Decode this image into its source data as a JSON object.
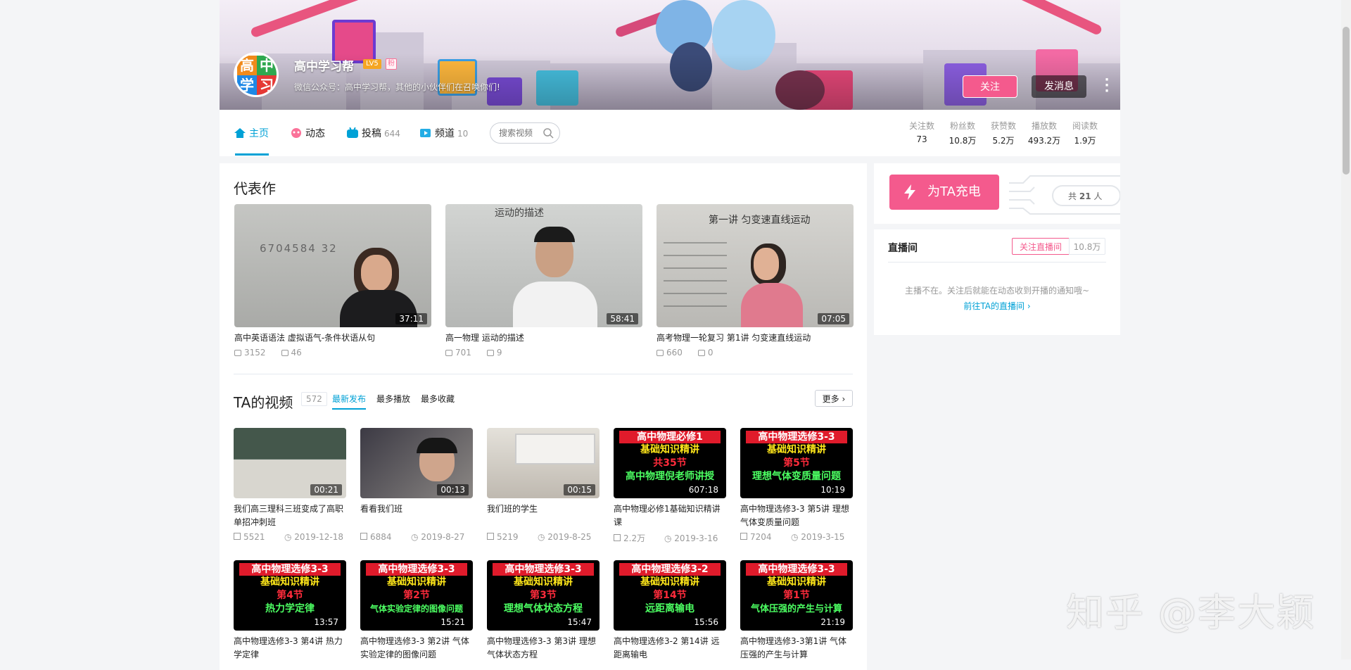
{
  "profile": {
    "name": "高中学习帮",
    "level": "LV5",
    "fan_badge": "粉",
    "avatar_text": [
      "高",
      "中",
      "学",
      "习"
    ],
    "sign": "微信公众号：高中学习帮，其他的小伙伴们在召唤你们!",
    "follow_label": "关注",
    "message_label": "发消息"
  },
  "nav": {
    "items": [
      {
        "label": "主页",
        "count": ""
      },
      {
        "label": "动态",
        "count": ""
      },
      {
        "label": "投稿",
        "count": "644"
      },
      {
        "label": "频道",
        "count": "10"
      }
    ],
    "search_placeholder": "搜索视频"
  },
  "stats": [
    {
      "label": "关注数",
      "value": "73"
    },
    {
      "label": "粉丝数",
      "value": "10.8万"
    },
    {
      "label": "获赞数",
      "value": "5.2万"
    },
    {
      "label": "播放数",
      "value": "493.2万"
    },
    {
      "label": "阅读数",
      "value": "1.9万"
    }
  ],
  "representative": {
    "title": "代表作",
    "items": [
      {
        "title": "高中英语语法 虚拟语气-条件状语从句",
        "duration": "37:11",
        "plays": "3152",
        "danmaku": "46",
        "board": "6704584 32",
        "bg": "#b9bab8"
      },
      {
        "title": "高一物理 运动的描述",
        "duration": "58:41",
        "plays": "701",
        "danmaku": "9",
        "board": "运动的描述",
        "bg": "#c4c6c4"
      },
      {
        "title": "高考物理一轮复习 第1讲 匀变速直线运动",
        "duration": "07:05",
        "plays": "660",
        "danmaku": "0",
        "board": "第一讲 匀变速直线运动",
        "bg": "#c9c8c4"
      }
    ]
  },
  "videos": {
    "title": "TA的视频",
    "count": "572",
    "tabs": [
      "最新发布",
      "最多播放",
      "最多收藏"
    ],
    "more_label": "更多",
    "row1": [
      {
        "title": "我们高三理科三班变成了高职单招冲刺班",
        "duration": "00:21",
        "plays": "5521",
        "date": "2019-12-18",
        "type": "photo",
        "bg": "#7d8c7f"
      },
      {
        "title": "看看我们班",
        "duration": "00:13",
        "plays": "6884",
        "date": "2019-8-27",
        "type": "photo",
        "bg": "#6e6a70"
      },
      {
        "title": "我们班的学生",
        "duration": "00:15",
        "plays": "5219",
        "date": "2019-8-25",
        "type": "photo",
        "bg": "#cfcac3"
      },
      {
        "title": "高中物理必修1基础知识精讲课",
        "duration": "607:18",
        "plays": "2.2万",
        "date": "2019-3-16",
        "type": "red",
        "lines": [
          "高中物理必修1",
          "基础知识精讲",
          "共35节",
          "高中物理倪老师讲授"
        ]
      },
      {
        "title": "高中物理选修3-3 第5讲 理想气体变质量问题",
        "duration": "10:19",
        "plays": "7204",
        "date": "2019-3-15",
        "type": "red",
        "lines": [
          "高中物理选修3-3",
          "基础知识精讲",
          "第5节",
          "理想气体变质量问题"
        ]
      }
    ],
    "row2": [
      {
        "title": "高中物理选修3-3 第4讲 热力学定律",
        "duration": "13:57",
        "lines": [
          "高中物理选修3-3",
          "基础知识精讲",
          "第4节",
          "热力学定律"
        ]
      },
      {
        "title": "高中物理选修3-3 第2讲 气体实验定律的图像问题",
        "duration": "15:21",
        "lines": [
          "高中物理选修3-3",
          "基础知识精讲",
          "第2节",
          "气体实验定律的图像问题"
        ]
      },
      {
        "title": "高中物理选修3-3 第3讲 理想气体状态方程",
        "duration": "15:47",
        "lines": [
          "高中物理选修3-3",
          "基础知识精讲",
          "第3节",
          "理想气体状态方程"
        ]
      },
      {
        "title": "高中物理选修3-2 第14讲 远距离输电",
        "duration": "15:56",
        "lines": [
          "高中物理选修3-2",
          "基础知识精讲",
          "第14节",
          "远距离输电"
        ]
      },
      {
        "title": "高中物理选修3-3第1讲 气体压强的产生与计算",
        "duration": "21:19",
        "lines": [
          "高中物理选修3-3",
          "基础知识精讲",
          "第1节",
          "气体压强的产生与计算"
        ]
      }
    ]
  },
  "charge": {
    "button_label": "为TA充电",
    "total_prefix": "共",
    "total": "21",
    "total_suffix": "人"
  },
  "live": {
    "title": "直播间",
    "follow_label": "关注直播间",
    "follow_count": "10.8万",
    "empty_text": "主播不在。关注后就能在动态收到开播的通知哦~",
    "link_text": "前往TA的直播间"
  },
  "watermark": "知乎 @李大颖",
  "colors": {
    "accent": "#00a1d6",
    "pink": "#f45a8d",
    "red_thumb": "#e01b2b"
  }
}
